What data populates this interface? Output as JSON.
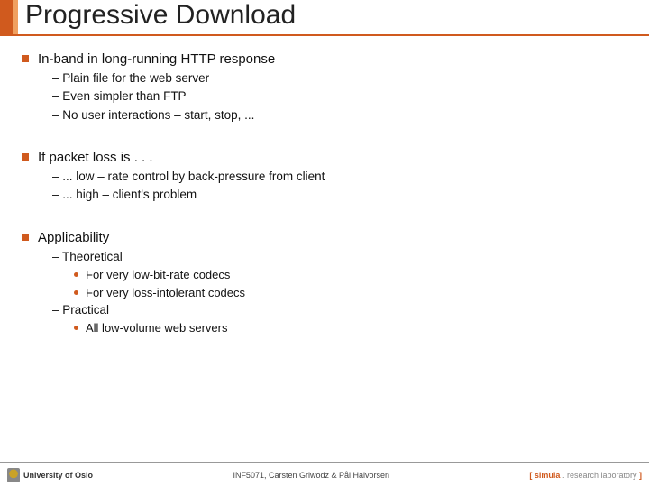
{
  "title": "Progressive Download",
  "sections": [
    {
      "heading": "In-band in long-running HTTP response",
      "subs": [
        {
          "text": "Plain file for the web server"
        },
        {
          "text": "Even simpler than FTP"
        },
        {
          "text": "No user interactions – start, stop, ..."
        }
      ]
    },
    {
      "heading": "If packet loss is . . .",
      "subs": [
        {
          "text": "... low – rate control by back-pressure from client"
        },
        {
          "text": "... high – client's problem"
        }
      ]
    },
    {
      "heading": "Applicability",
      "subs": [
        {
          "text": "Theoretical",
          "dots": [
            "For very low-bit-rate codecs",
            "For very loss-intolerant codecs"
          ]
        },
        {
          "text": "Practical",
          "dots": [
            "All low-volume web servers"
          ]
        }
      ]
    }
  ],
  "footer": {
    "left": "University of Oslo",
    "center": "INF5071, Carsten Griwodz & Pål Halvorsen",
    "right_open": "[ ",
    "right_brand": "simula",
    "right_dot": " . ",
    "right_rest": "research laboratory",
    "right_close": " ]"
  }
}
